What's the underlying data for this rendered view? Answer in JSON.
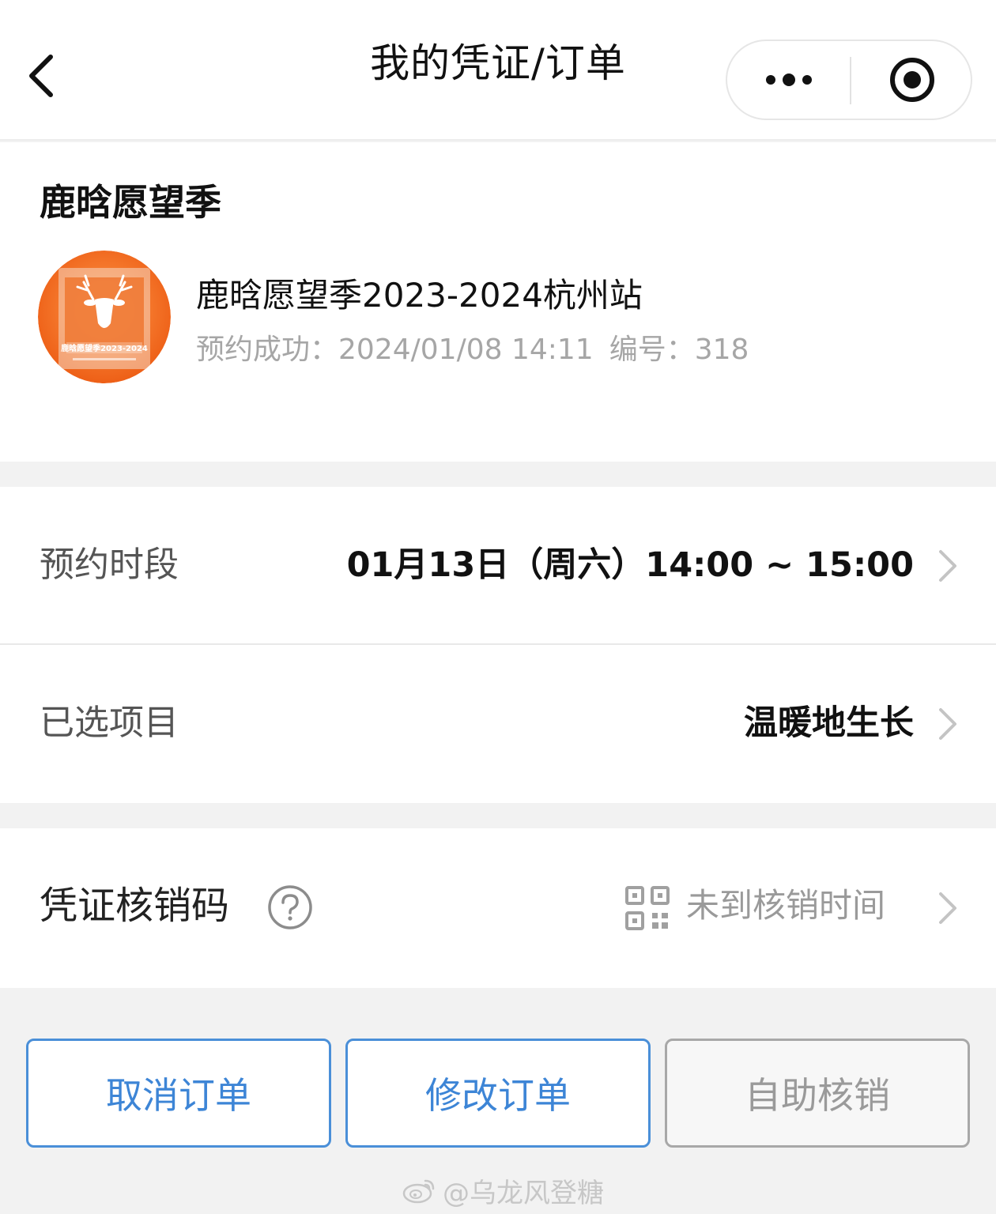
{
  "navbar": {
    "back_icon": "chevron-left-icon",
    "title": "我的凭证/订单",
    "more_icon": "more-dots-icon",
    "close_icon": "target-circle-icon"
  },
  "event": {
    "heading": "鹿晗愿望季",
    "thumbnail_icon": "deer-poster-image",
    "thumbnail_text": "鹿晗愿望季2023-2024",
    "name": "鹿晗愿望季2023-2024杭州站",
    "booked_label": "预约成功：",
    "booked_time": "2024/01/08 14:11",
    "number_label": "编号：",
    "number": "318"
  },
  "rows": [
    {
      "label": "预约时段",
      "value": "01月13日（周六）14:00 ~ 15:00"
    },
    {
      "label": "已选项目",
      "value": "温暖地生长"
    }
  ],
  "voucher": {
    "label": "凭证核销码",
    "help_icon": "question-circle-icon",
    "qr_icon": "qr-code-icon",
    "status": "未到核销时间"
  },
  "buttons": {
    "cancel": "取消订单",
    "modify": "修改订单",
    "self_verify": "自助核销"
  },
  "watermark": {
    "text": "@乌龙风登糖",
    "icon": "weibo-logo-icon"
  },
  "colors": {
    "accent_blue": "#3d85d6",
    "disabled_gray": "#9a9a9a",
    "thumbnail_orange": "#f06a1e"
  }
}
